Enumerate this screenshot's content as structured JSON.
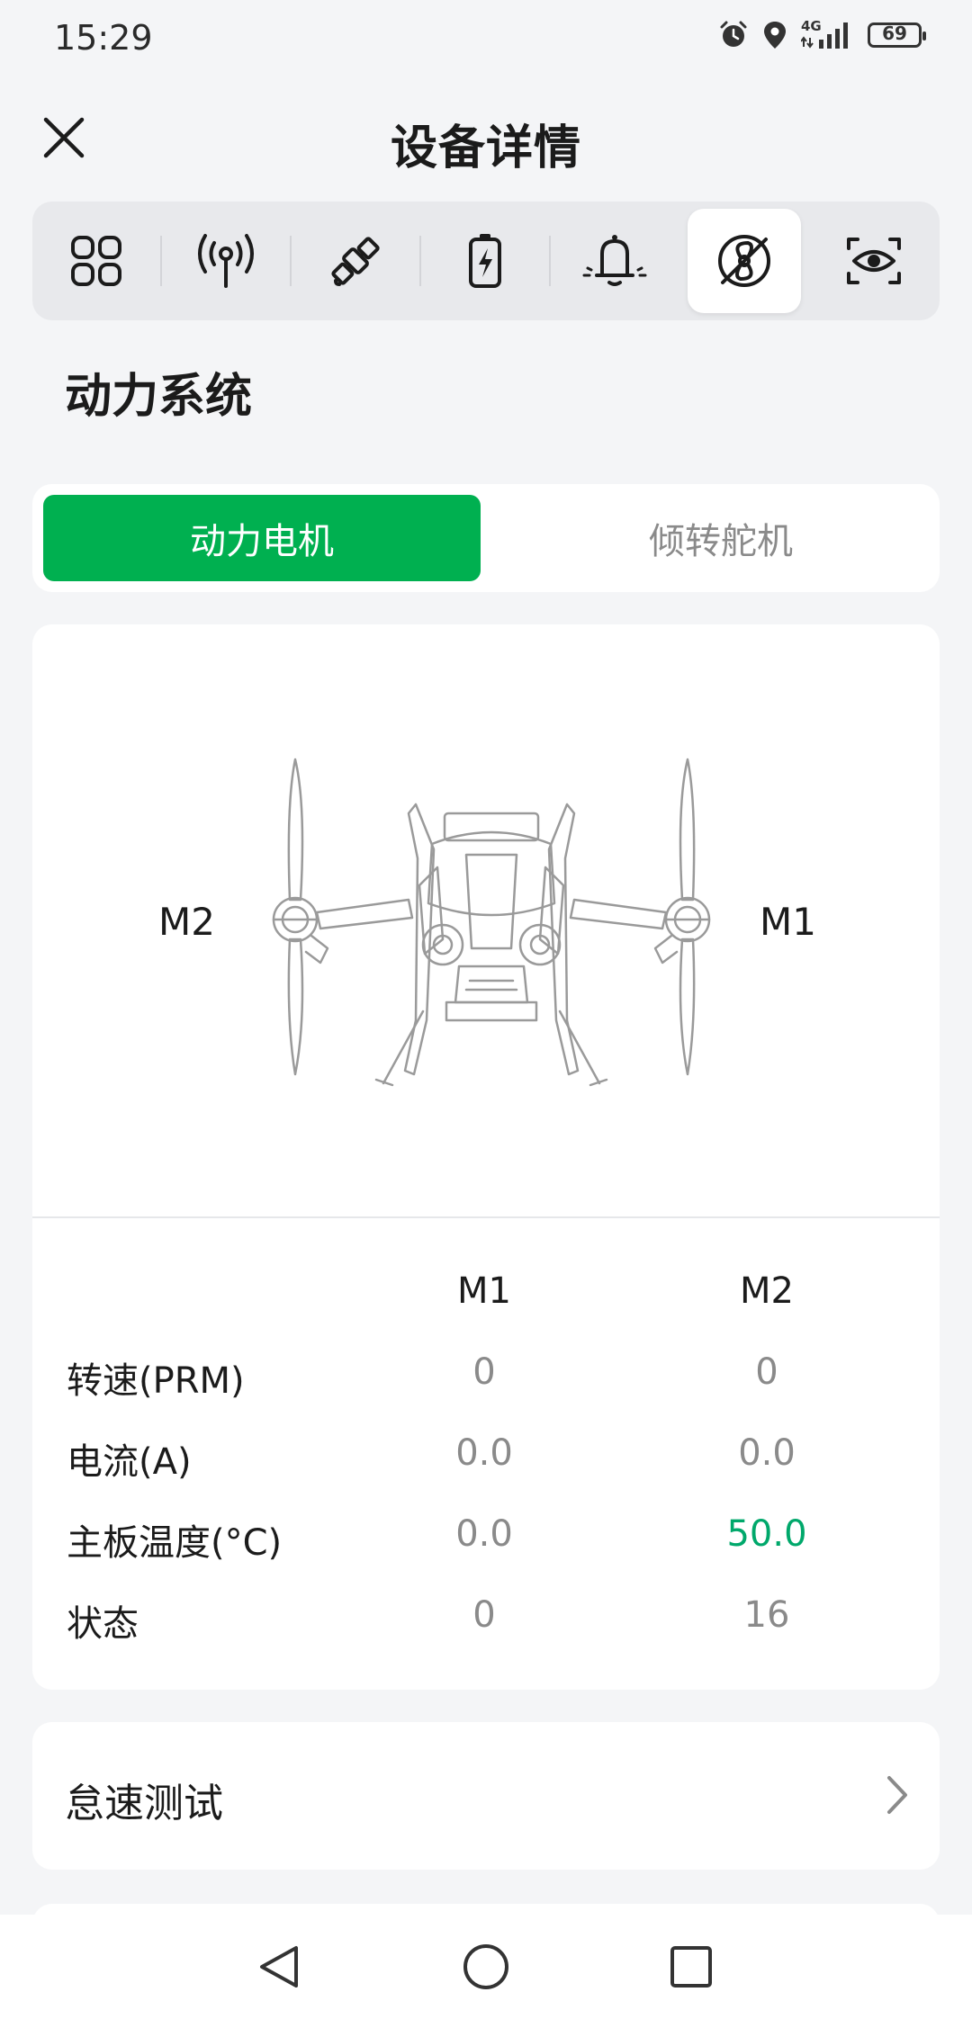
{
  "status": {
    "time": "15:29",
    "battery": "69",
    "network": "4G"
  },
  "header": {
    "title": "设备详情"
  },
  "icon_tabs": [
    {
      "icon": "grid-icon"
    },
    {
      "icon": "antenna-signal-icon"
    },
    {
      "icon": "satellite-icon"
    },
    {
      "icon": "battery-charging-icon"
    },
    {
      "icon": "alarm-bell-icon"
    },
    {
      "icon": "propeller-icon",
      "active": true
    },
    {
      "icon": "eye-scan-icon"
    }
  ],
  "section": {
    "title": "动力系统"
  },
  "segments": {
    "active": "动力电机",
    "inactive": "倾转舵机"
  },
  "drone": {
    "left_label": "M2",
    "right_label": "M1"
  },
  "table": {
    "headers": [
      "M1",
      "M2"
    ],
    "rows": [
      {
        "label": "转速(PRM)",
        "m1": "0",
        "m2": "0"
      },
      {
        "label": "电流(A)",
        "m1": "0.0",
        "m2": "0.0"
      },
      {
        "label": "主板温度(°C)",
        "m1": "0.0",
        "m2": "50.0"
      },
      {
        "label": "状态",
        "m1": "0",
        "m2": "16"
      }
    ]
  },
  "list": {
    "item1": "怠速测试"
  },
  "colors": {
    "accent": "#00b050",
    "highlight": "#00a86b"
  }
}
